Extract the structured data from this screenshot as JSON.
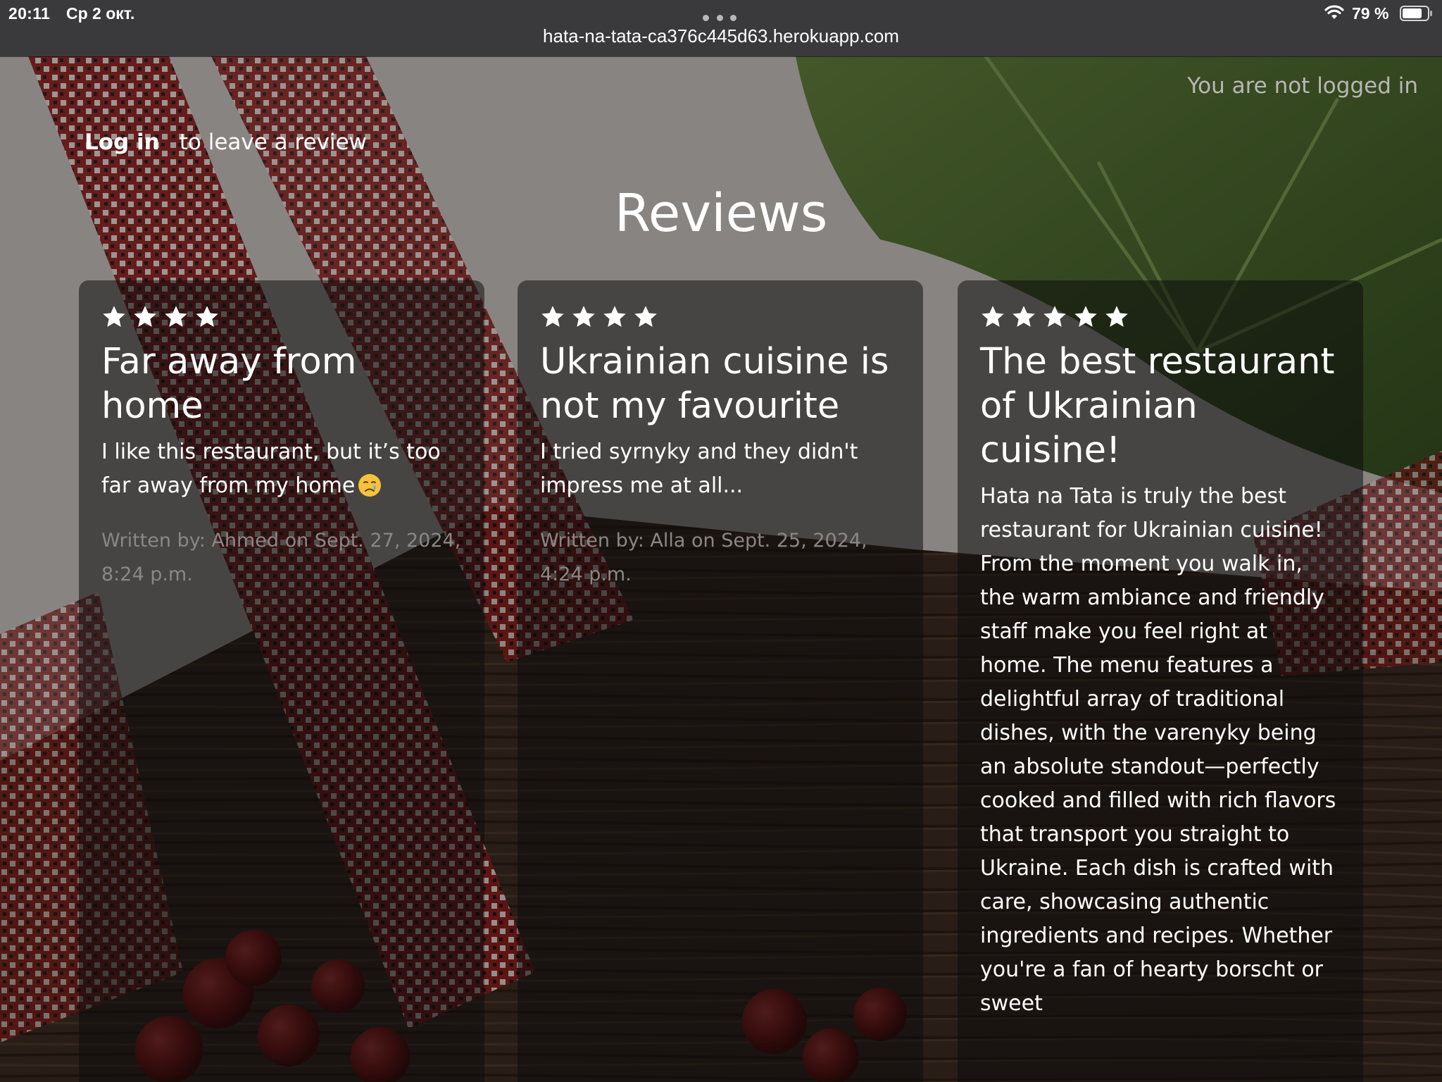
{
  "status_bar": {
    "time": "20:11",
    "date": "Ср 2 окт.",
    "battery": "79 %",
    "battery_level": 0.79,
    "wifi_icon": "wifi-icon",
    "battery_icon": "battery-icon"
  },
  "browser": {
    "url": "hata-na-tata-ca376c445d63.herokuapp.com",
    "more_icon": "more-dots-icon"
  },
  "header": {
    "login_status": "You are not logged in"
  },
  "login_prompt": {
    "link": "Log in",
    "text": "to leave a review"
  },
  "page": {
    "title": "Reviews"
  },
  "reviews": [
    {
      "rating": 4,
      "title": "Far away from home",
      "body": "I like this restaurant, but it’s too far away from my home",
      "emoji": "crying-face",
      "meta": "Written by: Ahmed on Sept. 27, 2024, 8:24 p.m."
    },
    {
      "rating": 4,
      "title": "Ukrainian cuisine is not my favourite",
      "body": "I tried syrnyky and they didn't impress me at all...",
      "meta": "Written by: Alla on Sept. 25, 2024, 4:24 p.m."
    },
    {
      "rating": 5,
      "title": "The best restaurant of Ukrainian cuisine!",
      "body": "Hata na Tata is truly the best restaurant for Ukrainian cuisine! From the moment you walk in, the warm ambiance and friendly staff make you feel right at home. The menu features a delightful array of traditional dishes, with the varenyky being an absolute standout—perfectly cooked and filled with rich flavors that transport you straight to Ukraine. Each dish is crafted with care, showcasing authentic ingredients and recipes. Whether you're a fan of hearty borscht or sweet"
    }
  ],
  "colors": {
    "card_background": "#0c0c0c",
    "meta_text": "#8a8784",
    "status_text": "#b9b6b3",
    "browser_bar": "#3a3a3c"
  }
}
